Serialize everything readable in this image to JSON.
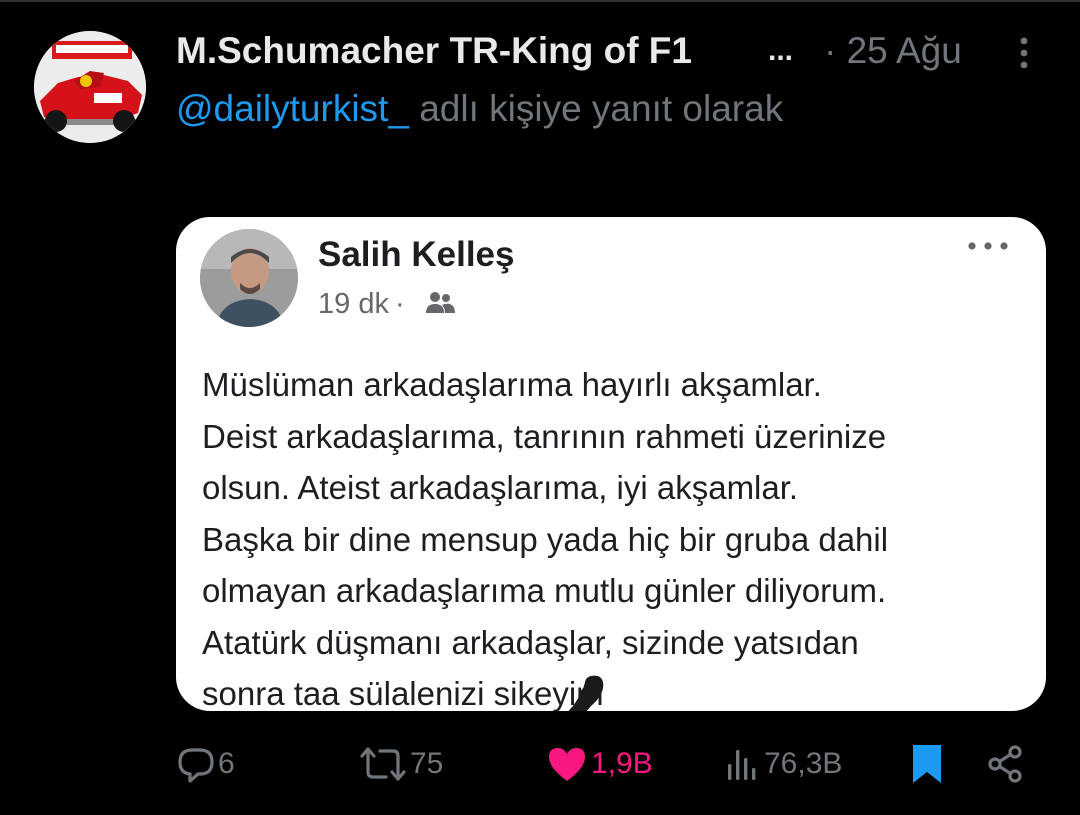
{
  "tweet": {
    "display_name": "M.Schumacher TR-King of F1",
    "name_truncation": "...",
    "date": "· 25 Ağu",
    "reply_to_handle": "@dailyturkist_",
    "reply_to_text": " adlı kişiye yanıt olarak"
  },
  "embedded_post": {
    "author": "Salih Kelleş",
    "time": "19 dk",
    "meta_separator": "·",
    "audience_icon": "friends-icon",
    "body": "Müslüman arkadaşlarıma hayırlı akşamlar.\nDeist arkadaşlarıma, tanrının rahmeti üzerinize\nolsun. Ateist arkadaşlarıma, iyi akşamlar.\nBaşka bir dine mensup yada hiç bir gruba dahil\nolmayan arkadaşlarıma mutlu günler diliyorum.\nAtatürk düşmanı arkadaşlar, sizinde yatsıdan\nsonra taa sülalenizi sikeyim"
  },
  "actions": {
    "replies": "6",
    "retweets": "75",
    "likes": "1,9B",
    "views": "76,3B"
  },
  "colors": {
    "background": "#000000",
    "text": "#e7e9ea",
    "muted": "#71767b",
    "link": "#1d9bf0",
    "like": "#f91880",
    "bookmark": "#1d9bf0"
  }
}
